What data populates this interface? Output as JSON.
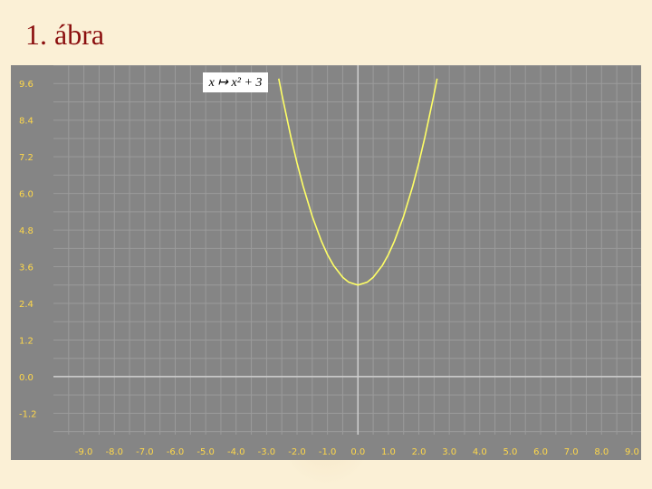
{
  "slide": {
    "title": "1. ábra"
  },
  "chart_data": {
    "type": "line",
    "formula_label": "x ↦ x² + 3",
    "function": "x^2 + 3",
    "x_ticks": [
      "-9.0",
      "-8.0",
      "-7.0",
      "-6.0",
      "-5.0",
      "-4.0",
      "-3.0",
      "-2.0",
      "-1.0",
      "0.0",
      "1.0",
      "2.0",
      "3.0",
      "4.0",
      "5.0",
      "6.0",
      "7.0",
      "8.0",
      "9.0"
    ],
    "y_ticks": [
      "9.6",
      "8.4",
      "7.2",
      "6.0",
      "4.8",
      "3.6",
      "2.4",
      "1.2",
      "0.0",
      "-1.2"
    ],
    "xlim": [
      -10,
      9.3
    ],
    "ylim": [
      -1.9,
      10.2
    ],
    "series": [
      {
        "x": [
          -2.6,
          -2.5,
          -2.2,
          -2.0,
          -1.8,
          -1.5,
          -1.2,
          -1.0,
          -0.8,
          -0.5,
          -0.3,
          0.0,
          0.3,
          0.5,
          0.8,
          1.0,
          1.2,
          1.5,
          1.8,
          2.0,
          2.2,
          2.5,
          2.6
        ],
        "y": [
          9.76,
          9.25,
          7.84,
          7.0,
          6.24,
          5.25,
          4.44,
          4.0,
          3.64,
          3.25,
          3.09,
          3.0,
          3.09,
          3.25,
          3.64,
          4.0,
          4.44,
          5.25,
          6.24,
          7.0,
          7.84,
          9.25,
          9.76
        ]
      }
    ],
    "colors": {
      "background": "#858585",
      "grid": "#9b9b9b",
      "axis": "#d0d0d0",
      "curve": "#ffff66",
      "labels": "#ffd84a"
    },
    "grid": true
  }
}
